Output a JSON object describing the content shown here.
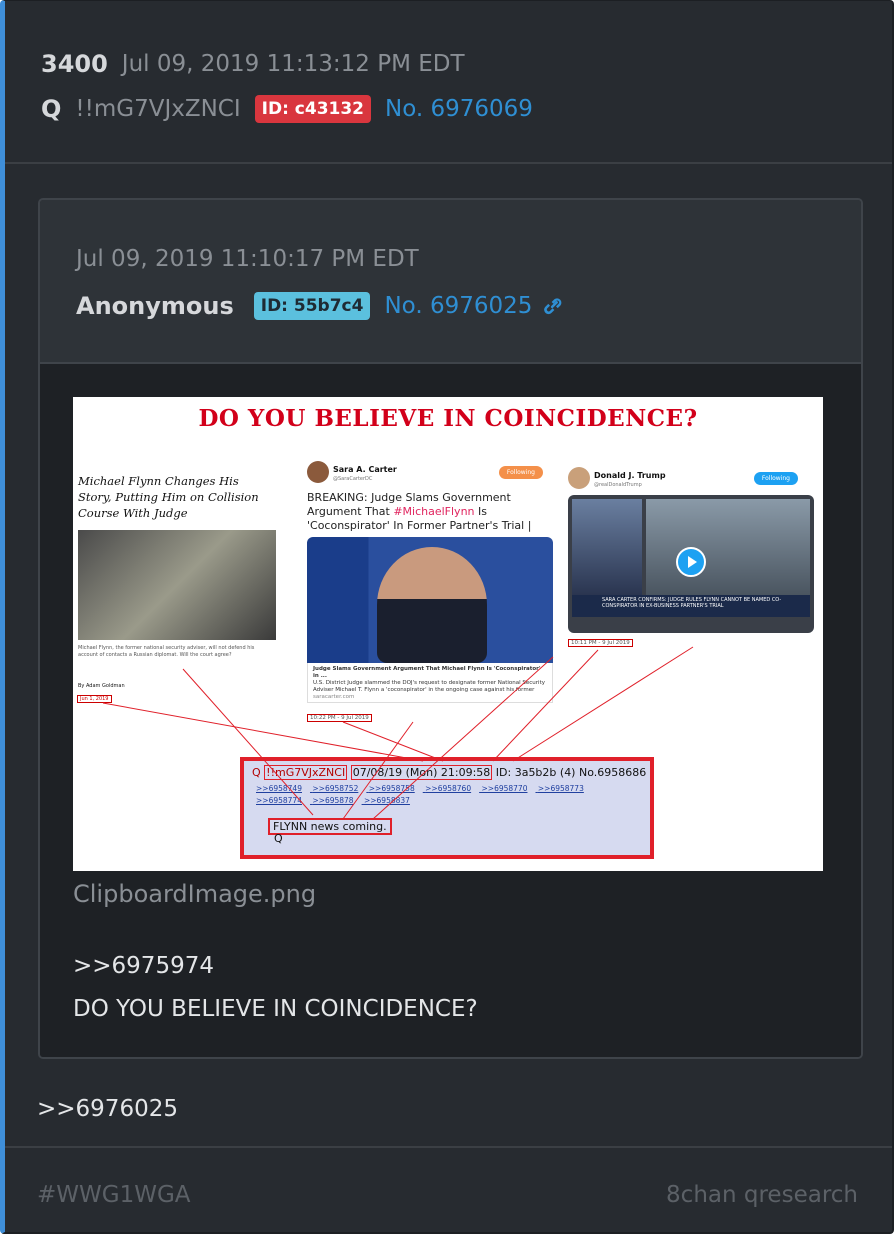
{
  "post": {
    "number": "3400",
    "date": "Jul 09, 2019 11:13:12 PM EDT",
    "author": "Q",
    "tripcode": "!!mG7VJxZNCI",
    "id_badge": "ID: c43132",
    "post_no": "No. 6976069",
    "reply_text": ">>6976025"
  },
  "quoted": {
    "date": "Jul 09, 2019 11:10:17 PM EDT",
    "author": "Anonymous",
    "id_badge": "ID: 55b7c4",
    "post_no": "No. 6976025",
    "filename": "ClipboardImage.png",
    "reply_ref": ">>6975974",
    "text": "DO YOU BELIEVE IN COINCIDENCE?"
  },
  "image": {
    "title": "DO YOU BELIEVE IN COINCIDENCE?",
    "article": {
      "headline": "Michael Flynn Changes His Story, Putting Him on Collision Course With Judge",
      "caption": "Michael Flynn, the former national security adviser, will not defend his account of contacts a Russian diplomat. Will the court agree?",
      "byline": "By Adam Goldman",
      "date": "Jun 1, 2019"
    },
    "tweet1": {
      "name": "Sara A. Carter",
      "handle": "@SaraCarterDC",
      "follow": "Following",
      "text_pre": "BREAKING: Judge Slams Government Argument That ",
      "text_hl": "#MichaelFlynn",
      "text_post": " Is 'Coconspirator' In Former Partner's Trial |",
      "card_title": "Judge Slams Government Argument That Michael Flynn Is 'Coconspirator' in ...",
      "card_desc": "U.S. District Judge slammed the DOJ's request to designate former National Security Adviser Michael T. Flynn a 'coconspirator' in the ongoing case against his former",
      "card_site": "saracarter.com",
      "timestamp": "10:22 PM - 9 Jul 2019"
    },
    "tweet2": {
      "name": "Donald J. Trump",
      "handle": "@realDonaldTrump",
      "follow": "Following",
      "lower_third": "SARA CARTER CONFIRMS: JUDGE RULES FLYNN CANNOT BE NAMED CO-CONSPIRATOR IN EX-BUSINESS PARTNER'S TRIAL",
      "timestamp": "10:11 PM - 9 Jul 2019"
    },
    "qpost": {
      "name": "Q",
      "trip": "!!mG7VJxZNCI",
      "date": "07/08/19 (Mon) 21:09:58",
      "id": "ID: 3a5b2b (4)",
      "no": "No.6958686",
      "links": [
        ">>6958749",
        ">>6958752",
        ">>6958758",
        ">>6958760",
        ">>6958770",
        ">>6958773",
        ">>6958774",
        ">>695878",
        ">>6958837"
      ],
      "message": "FLYNN news coming.",
      "signature": "Q"
    }
  },
  "footer": {
    "hashtag": "#WWG1WGA",
    "board": "8chan qresearch"
  },
  "colors": {
    "accent": "#3f8fd9",
    "id_red": "#d9363e",
    "id_teal": "#5bc0de",
    "link": "#2f8fd3"
  }
}
